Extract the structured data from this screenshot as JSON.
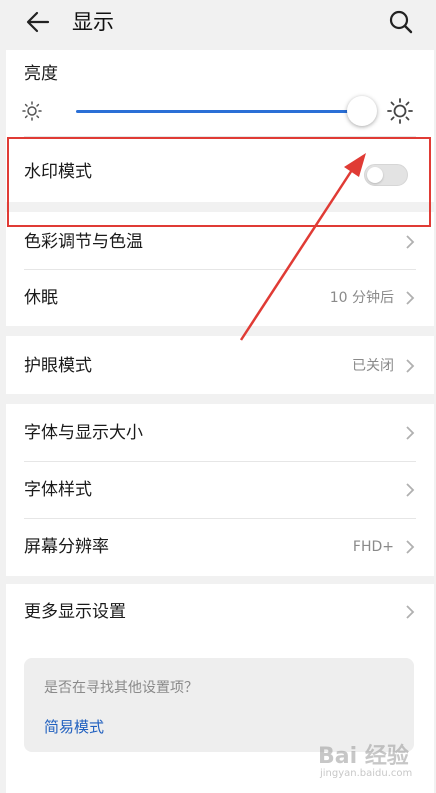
{
  "header": {
    "title": "显示",
    "back_icon": "arrow-left-icon",
    "search_icon": "search-icon"
  },
  "brightness": {
    "label": "亮度",
    "level_percent": 100
  },
  "watermark_mode": {
    "label": "水印模式",
    "enabled": false
  },
  "group1": [
    {
      "label": "色彩调节与色温",
      "value": ""
    },
    {
      "label": "休眠",
      "value": "10 分钟后"
    }
  ],
  "group2": [
    {
      "label": "护眼模式",
      "value": "已关闭"
    }
  ],
  "group3": [
    {
      "label": "字体与显示大小",
      "value": ""
    },
    {
      "label": "字体样式",
      "value": ""
    },
    {
      "label": "屏幕分辨率",
      "value": "FHD+"
    }
  ],
  "group4": [
    {
      "label": "更多显示设置",
      "value": ""
    }
  ],
  "tip": {
    "question": "是否在寻找其他设置项？",
    "link": "简易模式"
  },
  "colors": {
    "accent": "#2a6fd6",
    "link": "#1f5fbf",
    "annotation_red": "#e03b35",
    "background": "#f1f1f1"
  },
  "site_watermark": {
    "logo": "Bai 经验",
    "url": "jingyan.baidu.com"
  }
}
